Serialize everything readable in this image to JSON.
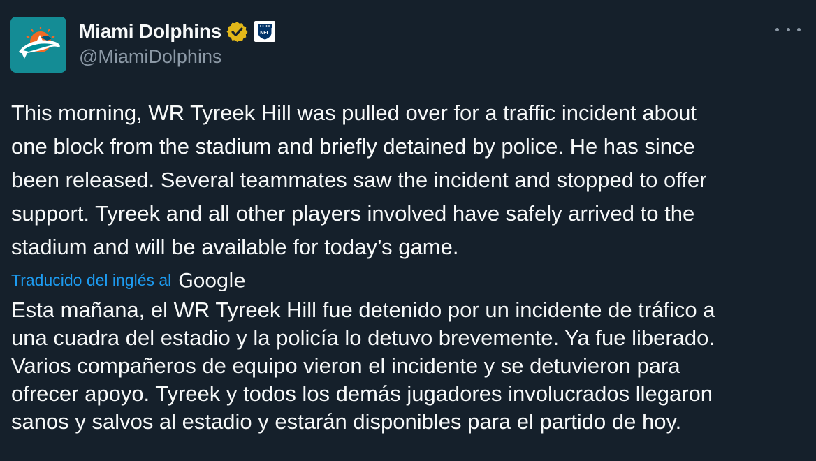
{
  "author": {
    "display_name": "Miami Dolphins",
    "handle": "@MiamiDolphins",
    "avatar_icon": "dolphin-logo-icon",
    "verified_icon": "gold-verified-badge-icon",
    "affiliation_icon": "nfl-shield-icon",
    "affiliation_text": "NFL"
  },
  "menu": {
    "more_icon": "ellipsis-icon"
  },
  "tweet": {
    "text": "This morning, WR Tyreek Hill was pulled over for a traffic incident about\none block from the stadium and briefly detained by police. He has since\nbeen released. Several teammates saw the incident and stopped to offer\nsupport. Tyreek and all other players involved have safely arrived to the\nstadium and will be available for today’s game."
  },
  "translation": {
    "label": "Traducido del inglés al",
    "provider": "Google",
    "text": "Esta mañana, el WR Tyreek Hill fue detenido por un incidente de tráfico a\nuna cuadra del estadio y la policía lo detuvo brevemente. Ya fue liberado.\nVarios compañeros de equipo vieron el incidente y se detuvieron para\nofrecer apoyo. Tyreek y todos los demás jugadores involucrados llegaron\nsanos y salvos al estadio y estarán disponibles para el partido de hoy."
  },
  "colors": {
    "background": "#15202b",
    "text": "#f7f9f9",
    "secondary_text": "#8b98a5",
    "link": "#1d9bf0",
    "verified_gold": "#e2b719",
    "avatar_teal": "#148c95",
    "dolphins_orange": "#f26a24"
  }
}
